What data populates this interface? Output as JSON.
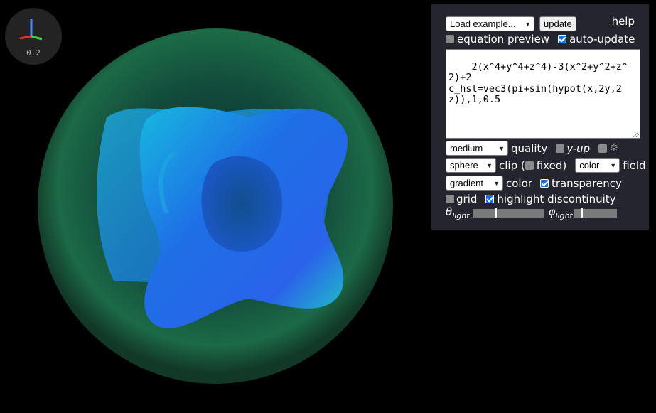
{
  "axes_widget": {
    "zoom_label": "0.2"
  },
  "toolbar": {
    "load_examples": "Load example...",
    "update_label": "update",
    "help_label": "help"
  },
  "options": {
    "equation_preview": {
      "label": "equation preview",
      "checked": false
    },
    "auto_update": {
      "label": "auto-update",
      "checked": true
    }
  },
  "equation": {
    "text": "2(x^4+y^4+z^4)-3(x^2+y^2+z^2)+2\nc_hsl=vec3(pi+sin(hypot(x,2y,2z)),1,0.5"
  },
  "render": {
    "quality_value": "medium",
    "quality_label": "quality",
    "y_up_label": "y-up",
    "y_up_checked": false,
    "sun_icon_label": "☼",
    "sun_checked": false,
    "clip_value": "sphere",
    "clip_label": "clip (",
    "fixed_label": "fixed)",
    "fixed_checked": false,
    "field_value": "color",
    "field_label": "field",
    "color_value": "gradient",
    "color_label": "color",
    "transparency_label": "transparency",
    "transparency_checked": true,
    "grid_label": "grid",
    "grid_checked": false,
    "highlight_label": "highlight discontinuity",
    "highlight_checked": true
  },
  "lighting": {
    "theta_symbol": "θ",
    "theta_sub": "light",
    "theta_value": 0.33,
    "phi_symbol": "φ",
    "phi_sub": "light",
    "phi_value": 0.17
  },
  "colors": {
    "panel_bg": "#252530",
    "checkbox_on": "#1a73e8",
    "surface_blue": "#1f6fe8",
    "surface_cyan": "#1ed2c8",
    "sphere_green": "#1d7a4a"
  }
}
